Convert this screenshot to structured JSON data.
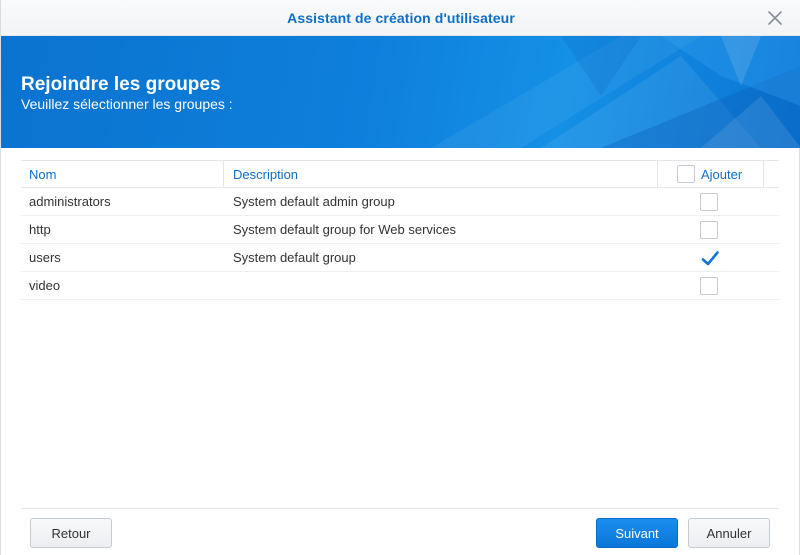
{
  "window": {
    "title": "Assistant de création d'utilisateur"
  },
  "banner": {
    "title": "Rejoindre les groupes",
    "subtitle": "Veuillez sélectionner les groupes :"
  },
  "table": {
    "columns": {
      "name": "Nom",
      "description": "Description",
      "add": "Ajouter"
    },
    "select_all_checked": false,
    "rows": [
      {
        "name": "administrators",
        "description": "System default admin group",
        "checked": false
      },
      {
        "name": "http",
        "description": "System default group for Web services",
        "checked": false
      },
      {
        "name": "users",
        "description": "System default group",
        "checked": true
      },
      {
        "name": "video",
        "description": "",
        "checked": false
      }
    ]
  },
  "buttons": {
    "back": "Retour",
    "next": "Suivant",
    "cancel": "Annuler"
  },
  "icons": {
    "close": "close-icon",
    "check": "checkmark-icon"
  },
  "colors": {
    "accent": "#0e6fc8",
    "banner": "#0b7ad6",
    "primary_button": "#1584e6"
  }
}
